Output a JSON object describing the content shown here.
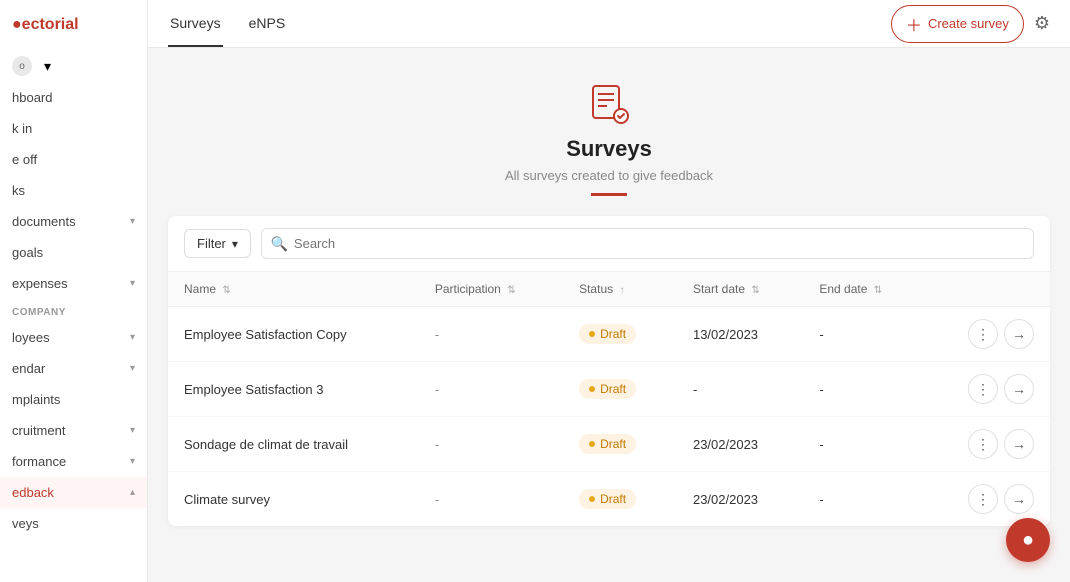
{
  "brand": {
    "name": "ectorial",
    "accent_color": "#c0392b"
  },
  "sidebar": {
    "org_label": "org",
    "items": [
      {
        "label": "hboard",
        "key": "dashboard",
        "has_chevron": false
      },
      {
        "label": "k in",
        "key": "check-in",
        "has_chevron": false
      },
      {
        "label": "e off",
        "key": "time-off",
        "has_chevron": false
      },
      {
        "label": "ks",
        "key": "tasks",
        "has_chevron": false
      },
      {
        "label": "documents",
        "key": "documents",
        "has_chevron": true
      },
      {
        "label": "goals",
        "key": "goals",
        "has_chevron": false
      },
      {
        "label": "expenses",
        "key": "expenses",
        "has_chevron": true
      }
    ],
    "company_section": "COMPANY",
    "company_items": [
      {
        "label": "loyees",
        "key": "employees",
        "has_chevron": true
      },
      {
        "label": "endar",
        "key": "calendar",
        "has_chevron": true
      },
      {
        "label": "mplaints",
        "key": "complaints",
        "has_chevron": false
      },
      {
        "label": "cruitment",
        "key": "recruitment",
        "has_chevron": true
      },
      {
        "label": "formance",
        "key": "performance",
        "has_chevron": true
      },
      {
        "label": "edback",
        "key": "feedback",
        "active": true,
        "has_chevron": true
      },
      {
        "label": "veys",
        "key": "surveys",
        "has_chevron": false
      }
    ]
  },
  "topnav": {
    "tabs": [
      {
        "label": "Surveys",
        "active": true
      },
      {
        "label": "eNPS",
        "active": false
      }
    ],
    "create_button": "Create survey",
    "settings_title": "Settings"
  },
  "hero": {
    "title": "Surveys",
    "subtitle": "All surveys created to give feedback"
  },
  "toolbar": {
    "filter_label": "Filter",
    "search_placeholder": "Search"
  },
  "table": {
    "columns": [
      {
        "label": "Name",
        "key": "name",
        "sortable": true
      },
      {
        "label": "Participation",
        "key": "participation",
        "sortable": true
      },
      {
        "label": "Status",
        "key": "status",
        "sortable": true,
        "sorted": true
      },
      {
        "label": "Start date",
        "key": "start_date",
        "sortable": true
      },
      {
        "label": "End date",
        "key": "end_date",
        "sortable": true
      }
    ],
    "rows": [
      {
        "name": "Employee Satisfaction Copy",
        "participation": "-",
        "status": "Draft",
        "start_date": "13/02/2023",
        "end_date": "-"
      },
      {
        "name": "Employee Satisfaction 3",
        "participation": "-",
        "status": "Draft",
        "start_date": "-",
        "end_date": "-"
      },
      {
        "name": "Sondage de climat de travail",
        "participation": "-",
        "status": "Draft",
        "start_date": "23/02/2023",
        "end_date": "-"
      },
      {
        "name": "Climate survey",
        "participation": "-",
        "status": "Draft",
        "start_date": "23/02/2023",
        "end_date": "-"
      }
    ]
  }
}
